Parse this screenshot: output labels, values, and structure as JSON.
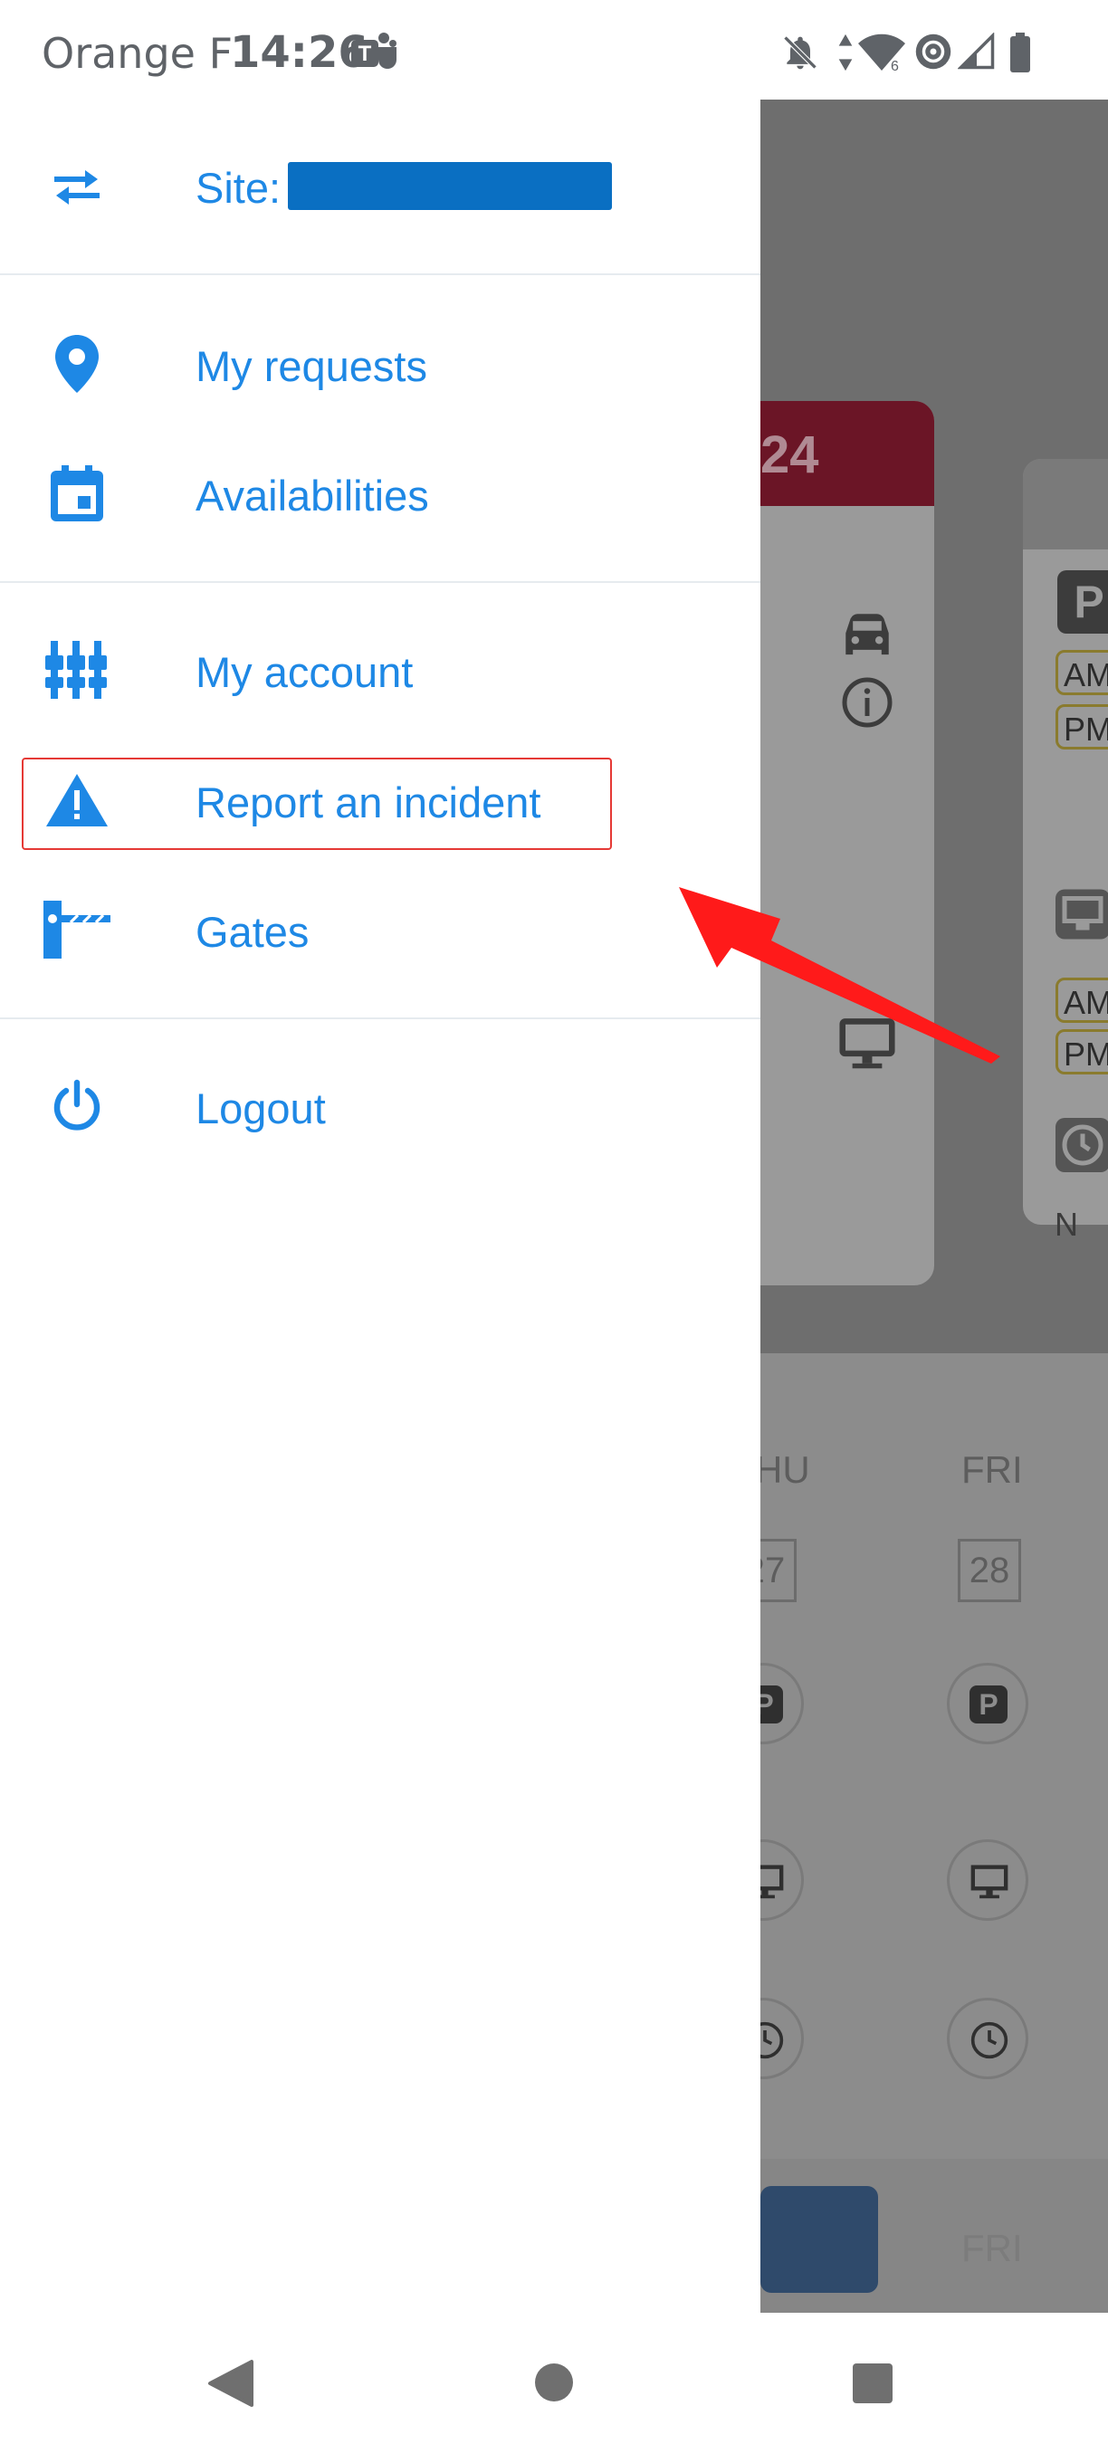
{
  "status_bar": {
    "carrier": "Orange F",
    "time": "14:26",
    "left_icons": [
      "teams-icon"
    ],
    "right_icons": [
      "notifications-off-icon",
      "data-arrows-icon",
      "wifi-icon",
      "hotspot-icon",
      "signal-icon",
      "battery-icon"
    ]
  },
  "drawer": {
    "site_label": "Site:",
    "site_value_redacted": true,
    "items": [
      {
        "label": "My requests",
        "icon": "location-pin-icon"
      },
      {
        "label": "Availabilities",
        "icon": "calendar-icon"
      },
      {
        "label": "My account",
        "icon": "settings-sliders-icon"
      },
      {
        "label": "Report an incident",
        "icon": "warning-icon",
        "highlighted": true
      },
      {
        "label": "Gates",
        "icon": "gate-barrier-icon"
      },
      {
        "label": "Logout",
        "icon": "power-icon"
      }
    ]
  },
  "background": {
    "card_date": "24",
    "chips": [
      "AM",
      "PM",
      "AM",
      "PM"
    ],
    "parking_label": "P",
    "days": [
      "HU",
      "FRI"
    ],
    "day_numbers": [
      "27",
      "28"
    ],
    "bottom_day": "FRI",
    "truncated_text": "N"
  },
  "colors": {
    "accent": "#1e88e5",
    "highlight": "#e53935",
    "arrow": "#ff1a1a",
    "card_header": "#6b1526"
  }
}
